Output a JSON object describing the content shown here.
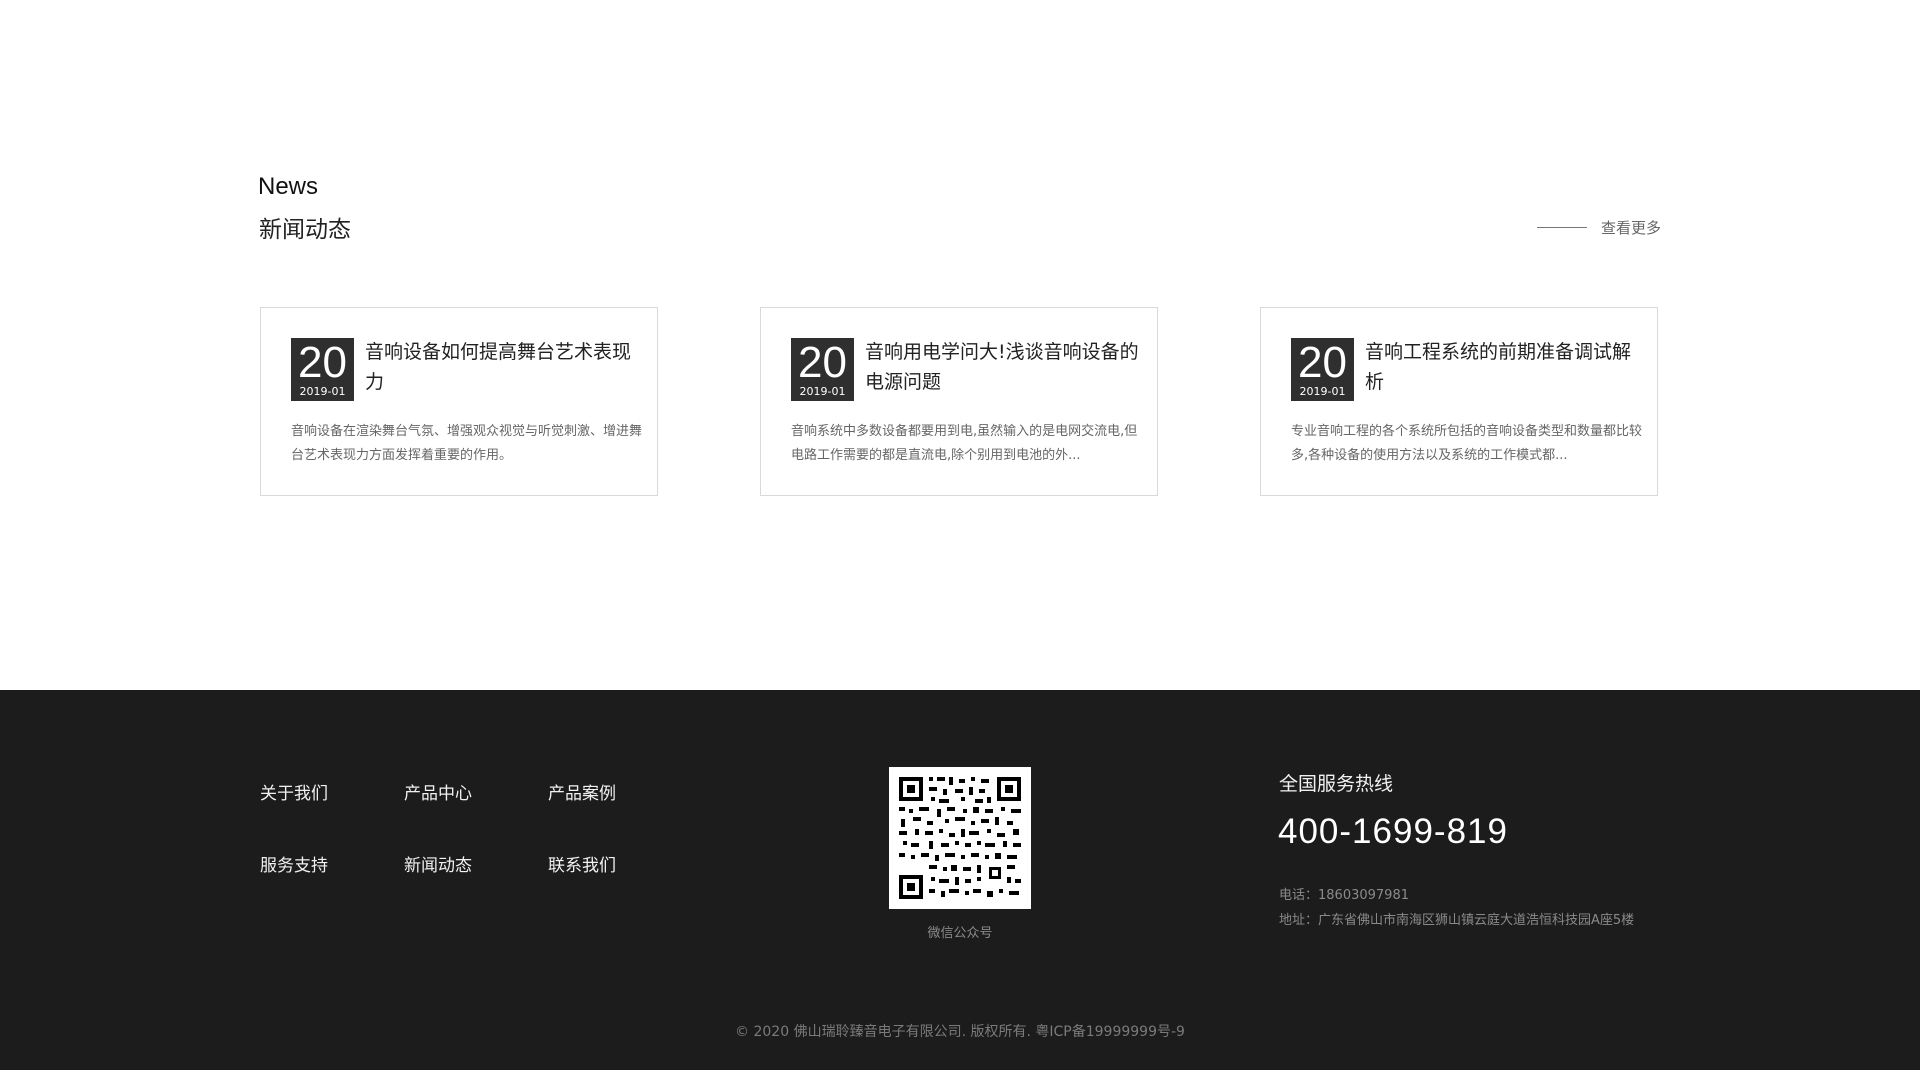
{
  "news_section": {
    "heading_en": "News",
    "heading_cn": "新闻动态",
    "view_more": "查看更多",
    "cards": [
      {
        "day": "20",
        "year_month": "2019-01",
        "title": "音响设备如何提高舞台艺术表现力",
        "summary": "音响设备在渲染舞台气氛、增强观众视觉与听觉刺激、增进舞台艺术表现力方面发挥着重要的作用。"
      },
      {
        "day": "20",
        "year_month": "2019-01",
        "title": "音响用电学问大!浅谈音响设备的电源问题",
        "summary": "音响系统中多数设备都要用到电,虽然输入的是电网交流电,但电路工作需要的都是直流电,除个别用到电池的外..."
      },
      {
        "day": "20",
        "year_month": "2019-01",
        "title": "音响工程系统的前期准备调试解析",
        "summary": "专业音响工程的各个系统所包括的音响设备类型和数量都比较多,各种设备的使用方法以及系统的工作模式都..."
      }
    ]
  },
  "footer": {
    "nav": [
      "关于我们",
      "产品中心",
      "产品案例",
      "服务支持",
      "新闻动态",
      "联系我们"
    ],
    "qr_label": "微信公众号",
    "hotline_label": "全国服务热线",
    "hotline_number": "400-1699-819",
    "phone": "电话：18603097981",
    "address": "地址：广东省佛山市南海区狮山镇云庭大道浩恒科技园A座5楼",
    "copyright": "© 2020 佛山瑞聆臻音电子有限公司. 版权所有. 粤ICP备19999999号-9"
  },
  "colors": {
    "footer_bg": "#1c1c1c",
    "date_badge_bg": "#2f2f2f",
    "card_border": "#d9d9d9"
  },
  "icons": {
    "qr": "qr-code-image"
  }
}
